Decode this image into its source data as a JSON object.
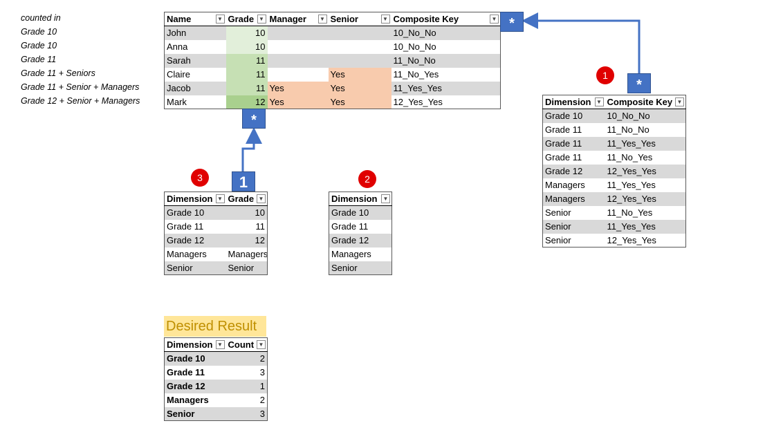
{
  "notes": {
    "header": "counted in",
    "lines": [
      "Grade 10",
      "Grade 10",
      "Grade 11",
      "Grade 11 + Seniors",
      "Grade 11 + Senior + Managers",
      "Grade 12 + Senior + Managers"
    ]
  },
  "main_table": {
    "headers": [
      "Name",
      "Grade",
      "Manager",
      "Senior",
      "Composite Key"
    ],
    "rows": [
      {
        "name": "John",
        "grade": "10",
        "manager": "",
        "senior": "",
        "key": "10_No_No"
      },
      {
        "name": "Anna",
        "grade": "10",
        "manager": "",
        "senior": "",
        "key": "10_No_No"
      },
      {
        "name": "Sarah",
        "grade": "11",
        "manager": "",
        "senior": "",
        "key": "11_No_No"
      },
      {
        "name": "Claire",
        "grade": "11",
        "manager": "",
        "senior": "Yes",
        "key": "11_No_Yes"
      },
      {
        "name": "Jacob",
        "grade": "11",
        "manager": "Yes",
        "senior": "Yes",
        "key": "11_Yes_Yes"
      },
      {
        "name": "Mark",
        "grade": "12",
        "manager": "Yes",
        "senior": "Yes",
        "key": "12_Yes_Yes"
      }
    ]
  },
  "key_table": {
    "headers": [
      "Dimension",
      "Composite Key"
    ],
    "rows": [
      [
        "Grade 10",
        "10_No_No"
      ],
      [
        "Grade 11",
        "11_No_No"
      ],
      [
        "Grade 11",
        "11_Yes_Yes"
      ],
      [
        "Grade 11",
        "11_No_Yes"
      ],
      [
        "Grade 12",
        "12_Yes_Yes"
      ],
      [
        "Managers",
        "11_Yes_Yes"
      ],
      [
        "Managers",
        "12_Yes_Yes"
      ],
      [
        "Senior",
        "11_No_Yes"
      ],
      [
        "Senior",
        "11_Yes_Yes"
      ],
      [
        "Senior",
        "12_Yes_Yes"
      ]
    ]
  },
  "dim_grade_table": {
    "headers": [
      "Dimension",
      "Grade"
    ],
    "rows": [
      [
        "Grade 10",
        "10"
      ],
      [
        "Grade 11",
        "11"
      ],
      [
        "Grade 12",
        "12"
      ],
      [
        "Managers",
        "Managers"
      ],
      [
        "Senior",
        "Senior"
      ]
    ]
  },
  "dim_table": {
    "headers": [
      "Dimension"
    ],
    "rows": [
      "Grade 10",
      "Grade 11",
      "Grade 12",
      "Managers",
      "Senior"
    ]
  },
  "desired": {
    "title": "Desired Result",
    "headers": [
      "Dimension",
      "Count"
    ],
    "rows": [
      [
        "Grade 10",
        "2"
      ],
      [
        "Grade 11",
        "3"
      ],
      [
        "Grade 12",
        "1"
      ],
      [
        "Managers",
        "2"
      ],
      [
        "Senior",
        "3"
      ]
    ]
  },
  "markers": {
    "many": "*",
    "one": "1",
    "circle_1": "1",
    "circle_2": "2",
    "circle_3": "3"
  },
  "colors": {
    "relationship_blue": "#4472c4",
    "marker_red": "#e00000",
    "grade_10": "#e2efda",
    "grade_11": "#c6e0b4",
    "grade_12": "#a9d08e",
    "flag_yes": "#f8cbad",
    "desired_fill": "#ffe699",
    "desired_text": "#bf8f00"
  }
}
